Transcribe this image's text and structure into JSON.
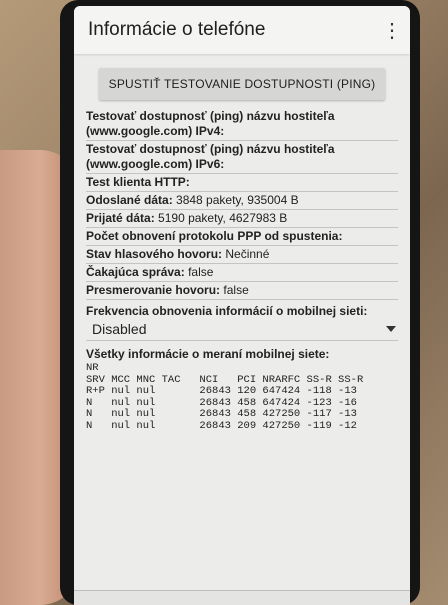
{
  "appbar": {
    "title": "Informácie o telefóne",
    "overflow_icon": "more-vert-icon"
  },
  "ping_button": "SPUSTIŤ TESTOVANIE DOSTUPNOSTI (PING)",
  "rows": [
    {
      "label": "Testovať dostupnosť (ping) názvu hostiteľa (www.google.com) IPv4:",
      "value": ""
    },
    {
      "label": "Testovať dostupnosť (ping) názvu hostiteľa (www.google.com) IPv6:",
      "value": ""
    },
    {
      "label": "Test klienta HTTP:",
      "value": ""
    },
    {
      "label": "Odoslané dáta:",
      "value": "3848 pakety, 935004 B"
    },
    {
      "label": "Prijaté dáta:",
      "value": "5190 pakety, 4627983 B"
    },
    {
      "label": "Počet obnovení protokolu PPP od spustenia:",
      "value": ""
    },
    {
      "label": "Stav hlasového hovoru:",
      "value": "Nečinné"
    },
    {
      "label": "Čakajúca správa:",
      "value": "false"
    },
    {
      "label": "Presmerovanie hovoru:",
      "value": "false"
    }
  ],
  "frequency": {
    "label": "Frekvencia obnovenia informácií o mobilnej sieti:",
    "value": "Disabled"
  },
  "cell_info": {
    "label": "Všetky informácie o meraní mobilnej siete:",
    "header_line1": "NR",
    "header_line2": "SRV MCC MNC TAC   NCI   PCI NRARFC SS-R SS-R",
    "lines": [
      "R+P nul nul       26843 120 647424 -118 -13",
      "N   nul nul       26843 458 647424 -123 -16",
      "N   nul nul       26843 458 427250 -117 -13",
      "N   nul nul       26843 209 427250 -119 -12"
    ]
  }
}
